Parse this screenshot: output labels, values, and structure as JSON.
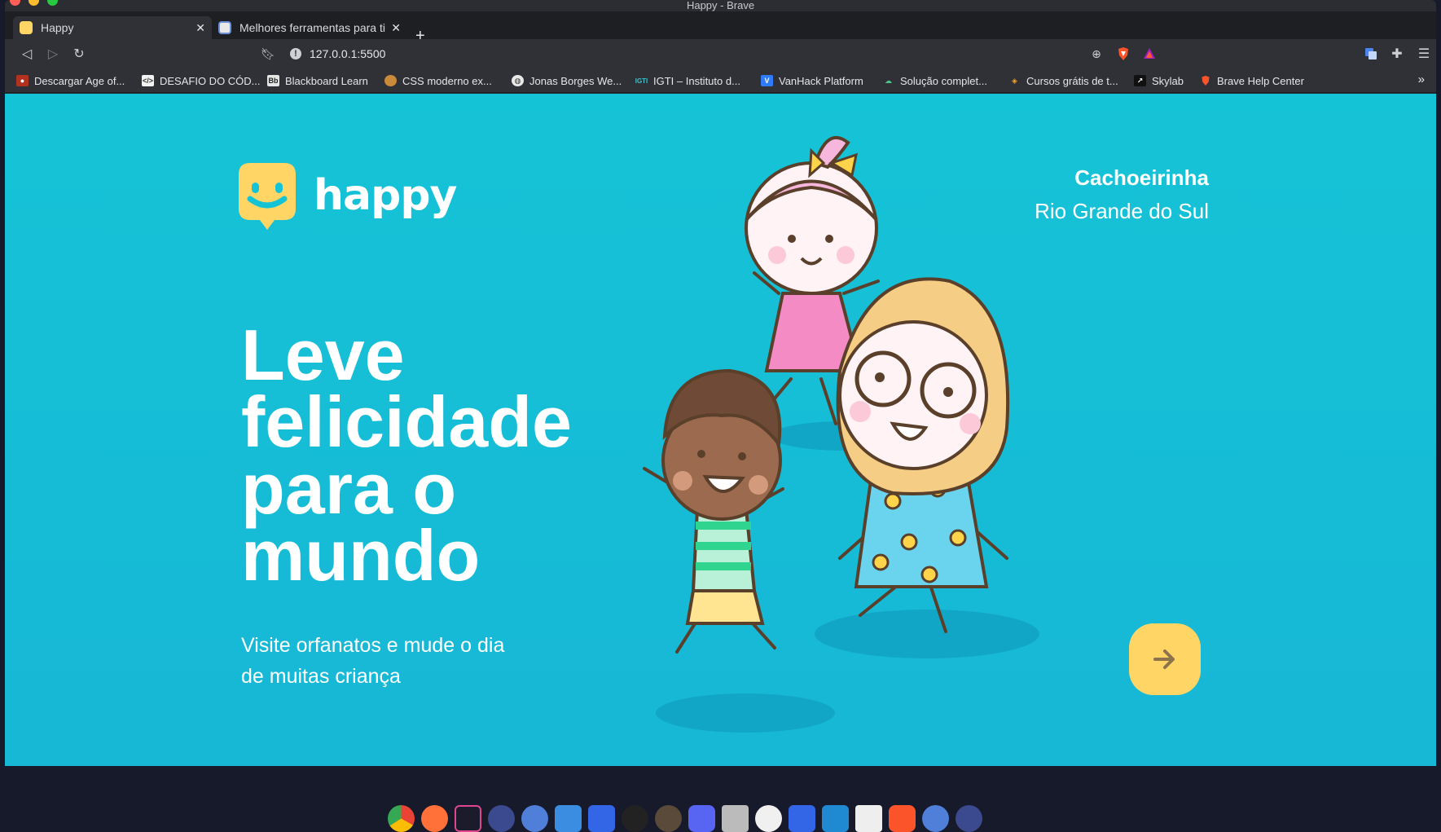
{
  "window": {
    "title": "Happy - Brave"
  },
  "tabs": [
    {
      "label": "Happy",
      "active": true
    },
    {
      "label": "Melhores ferramentas para tirar",
      "active": false
    }
  ],
  "toolbar": {
    "url": "127.0.0.1:5500"
  },
  "bookmarks": [
    {
      "label": "Descargar Age of...",
      "icon": "aoe-icon"
    },
    {
      "label": "DESAFIO DO CÓD...",
      "icon": "code-icon"
    },
    {
      "label": "Blackboard Learn",
      "icon": "bb-icon"
    },
    {
      "label": "CSS moderno ex...",
      "icon": "person-icon"
    },
    {
      "label": "Jonas Borges We...",
      "icon": "globe-icon"
    },
    {
      "label": "IGTI – Instituto d...",
      "icon": "igti-icon"
    },
    {
      "label": "VanHack Platform",
      "icon": "vanhack-icon"
    },
    {
      "label": "Solução complet...",
      "icon": "cloud-icon"
    },
    {
      "label": "Cursos grátis de t...",
      "icon": "layers-icon"
    },
    {
      "label": "Skylab",
      "icon": "skylab-icon"
    },
    {
      "label": "Brave Help Center",
      "icon": "brave-icon"
    }
  ],
  "page": {
    "logo_text": "happy",
    "location": {
      "city": "Cachoeirinha",
      "state": "Rio Grande do Sul"
    },
    "headline": "Leve felicidade para o mundo",
    "subtitle": "Visite orfanatos e mude o dia de muitas criança",
    "colors": {
      "background": "#15c3d6",
      "accent": "#ffd666",
      "arrow": "#8d734b"
    }
  }
}
